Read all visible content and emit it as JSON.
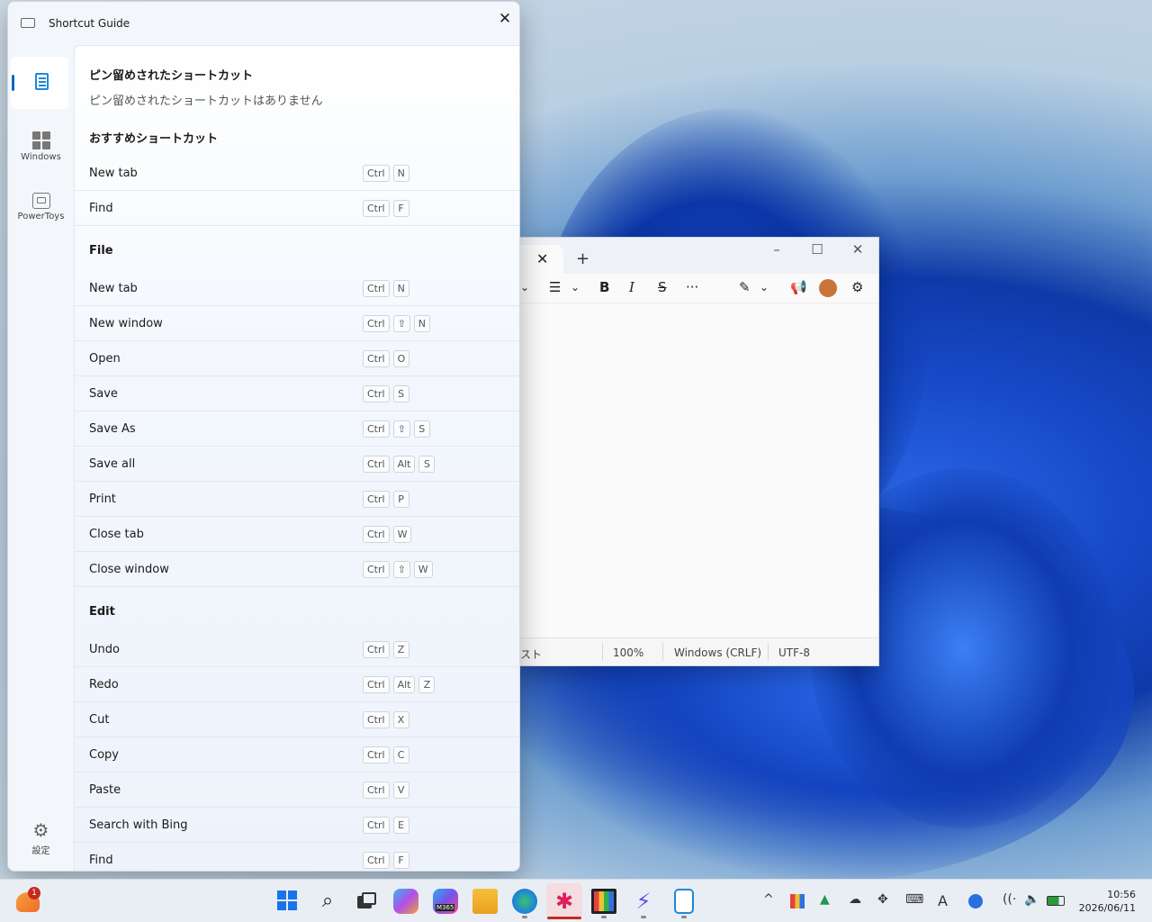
{
  "shortcut_guide": {
    "title": "Shortcut Guide",
    "nav": {
      "windows_label": "Windows",
      "powertoys_label": "PowerToys",
      "settings_label": "設定"
    },
    "pinned_heading": "ピン留めされたショートカット",
    "pinned_empty": "ピン留めされたショートカットはありません",
    "sections": [
      {
        "title": "おすすめショートカット",
        "rows": [
          {
            "label": "New tab",
            "keys": [
              "Ctrl",
              "N"
            ]
          },
          {
            "label": "Find",
            "keys": [
              "Ctrl",
              "F"
            ]
          }
        ]
      },
      {
        "title": "File",
        "rows": [
          {
            "label": "New tab",
            "keys": [
              "Ctrl",
              "N"
            ]
          },
          {
            "label": "New window",
            "keys": [
              "Ctrl",
              "⇧",
              "N"
            ]
          },
          {
            "label": "Open",
            "keys": [
              "Ctrl",
              "O"
            ]
          },
          {
            "label": "Save",
            "keys": [
              "Ctrl",
              "S"
            ]
          },
          {
            "label": "Save As",
            "keys": [
              "Ctrl",
              "⇧",
              "S"
            ]
          },
          {
            "label": "Save all",
            "keys": [
              "Ctrl",
              "Alt",
              "S"
            ]
          },
          {
            "label": "Print",
            "keys": [
              "Ctrl",
              "P"
            ]
          },
          {
            "label": "Close tab",
            "keys": [
              "Ctrl",
              "W"
            ]
          },
          {
            "label": "Close window",
            "keys": [
              "Ctrl",
              "⇧",
              "W"
            ]
          }
        ]
      },
      {
        "title": "Edit",
        "rows": [
          {
            "label": "Undo",
            "keys": [
              "Ctrl",
              "Z"
            ]
          },
          {
            "label": "Redo",
            "keys": [
              "Ctrl",
              "Alt",
              "Z"
            ]
          },
          {
            "label": "Cut",
            "keys": [
              "Ctrl",
              "X"
            ]
          },
          {
            "label": "Copy",
            "keys": [
              "Ctrl",
              "C"
            ]
          },
          {
            "label": "Paste",
            "keys": [
              "Ctrl",
              "V"
            ]
          },
          {
            "label": "Search with Bing",
            "keys": [
              "Ctrl",
              "E"
            ]
          },
          {
            "label": "Find",
            "keys": [
              "Ctrl",
              "F"
            ]
          }
        ]
      }
    ]
  },
  "notepad": {
    "status": {
      "text_fragment": "スト",
      "zoom": "100%",
      "line_ending": "Windows (CRLF)",
      "encoding": "UTF-8"
    }
  },
  "taskbar": {
    "weather_badge": "1",
    "m365_label": "M365",
    "time": "10:56",
    "date": "2026/06/11",
    "ime_label": "A"
  }
}
